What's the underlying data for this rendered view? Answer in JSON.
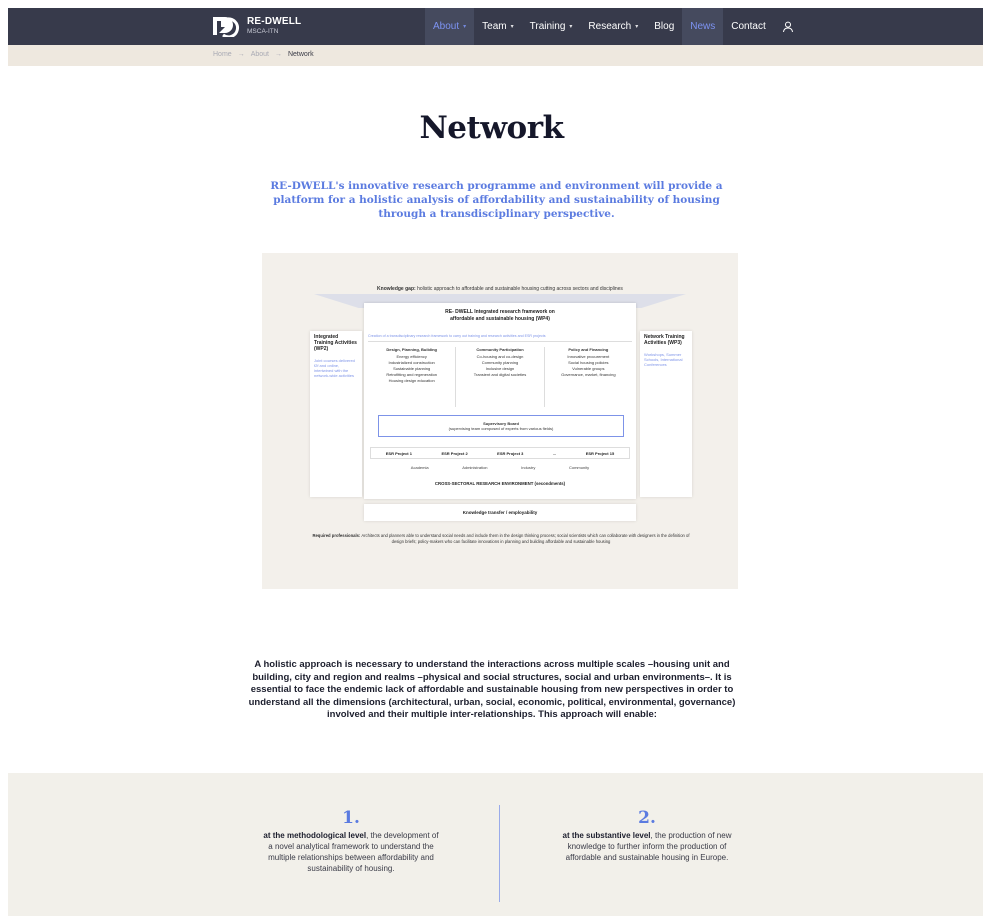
{
  "nav": {
    "logo_title": "RE-DWELL",
    "logo_subtitle": "MSCA-ITN",
    "items": [
      {
        "label": "About",
        "caret": "▾"
      },
      {
        "label": "Team",
        "caret": "▾"
      },
      {
        "label": "Training",
        "caret": "▾"
      },
      {
        "label": "Research",
        "caret": "▾"
      },
      {
        "label": "Blog"
      },
      {
        "label": "News"
      },
      {
        "label": "Contact"
      }
    ],
    "user_icon": "user-icon"
  },
  "breadcrumb": {
    "home": "Home",
    "about": "About",
    "current": "Network",
    "separator": "→"
  },
  "page": {
    "title": "Network",
    "intro": "RE-DWELL's innovative research programme and environment will provide a platform for a holistic analysis of affordability and sustainability of housing through a transdisciplinary perspective."
  },
  "diagram": {
    "gap_label": "Knowledge gap:",
    "gap_text": "holistic approach to affordable and sustainable housing cutting across sectors and disciplines",
    "main_title_1": "RE- DWELL Integrated research framework on",
    "main_title_2": "affordable and sustainable housing (WP4)",
    "creation": "Creation of a transdisciplinary research framework to carry out training and research activities and ESR projects",
    "columns": [
      {
        "heading": "Design, Planning, Building",
        "items": [
          "Energy efficiency",
          "Industrialized construction",
          "Sustainable planning",
          "Retrofitting and regeneration",
          "Housing design education"
        ]
      },
      {
        "heading": "Community Participation",
        "items": [
          "Co-housing and co-design",
          "Community planning",
          "Inclusive design",
          "Transient and digital societies"
        ]
      },
      {
        "heading": "Policy and Financing",
        "items": [
          "Innovative procurement",
          "Social housing policies",
          "Vulnerable groups",
          "Governance, market, financing"
        ]
      }
    ],
    "board_title": "Supervisory Board",
    "board_text": "(supervising team composed of experts from various fields)",
    "esr": [
      "ESR Project 1",
      "ESR Project 2",
      "ESR Project 3",
      "...",
      "ESR Project 15"
    ],
    "sectors": [
      "Academia",
      "Administration",
      "Industry",
      "Community"
    ],
    "cross_sectoral": "CROSS-SECTORAL RESEARCH ENVIRONMENT (secondments)",
    "left_title": "Integrated Training Activities (WP2)",
    "left_text": "Joint courses delivered f2f and online, intertwined with the network-wide activities",
    "right_title": "Network Training Activities (WP3)",
    "right_text": "Workshops, Summer Schools, International Conferences",
    "transfer": "Knowledge transfer / employability",
    "required_label": "Required professionals:",
    "required_text": "Architects and planners able to understand social needs and include them in the design thinking process; social scientists which can collaborate with designers in the definition of design briefs; policy-makers who can facilitate innovations in planning and building affordable and sustainable housing"
  },
  "body_text": "A holistic approach is necessary to understand the interactions across multiple scales –housing unit and building, city and region and realms –physical and social structures, social and urban environments–. It is essential to face the endemic lack of affordable and sustainable housing from new perspectives in order to understand all the dimensions (architectural, urban, social, economic, political, environmental, governance) involved and their multiple inter-relationships. This approach will enable:",
  "levels": [
    {
      "number": "1.",
      "lead": "at the methodological level",
      "text": ", the development of a novel analytical framework to understand the multiple relationships between affordability and sustainability of housing."
    },
    {
      "number": "2.",
      "lead": "at the substantive level",
      "text": ", the production of new knowledge to further inform the production of affordable and sustainable housing in Europe."
    }
  ],
  "colors": {
    "nav_bg": "#373a4b",
    "accent": "#5b7be0",
    "active_link": "#7d93f2",
    "breadcrumb_bg": "#eee8df",
    "levels_bg": "#f2f0ea"
  }
}
